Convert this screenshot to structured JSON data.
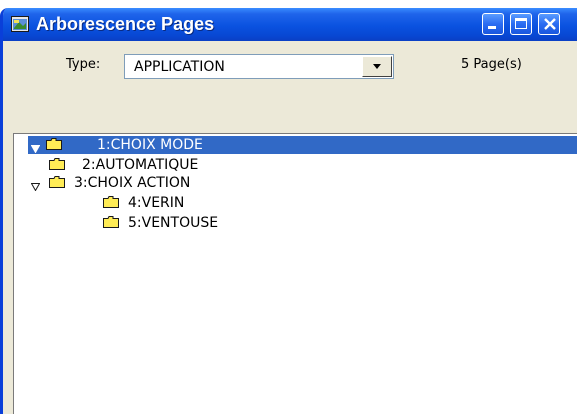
{
  "window": {
    "title": "Arborescence Pages",
    "title_bar_color": "#0a52e0"
  },
  "toolbar": {
    "type_label": "Type:",
    "type_selected": "APPLICATION",
    "page_count": "5  Page(s)"
  },
  "tree": {
    "selection_color": "#3169c6",
    "folder_color": "#ffec56",
    "nodes": [
      {
        "label": "1:CHOIX MODE",
        "level": 0,
        "expanded": true,
        "selected": true
      },
      {
        "label": "2:AUTOMATIQUE",
        "level": 1,
        "expanded": null,
        "selected": false
      },
      {
        "label": "3:CHOIX ACTION",
        "level": 1,
        "expanded": true,
        "selected": false
      },
      {
        "label": "4:VERIN",
        "level": 2,
        "expanded": null,
        "selected": false
      },
      {
        "label": "5:VENTOUSE",
        "level": 2,
        "expanded": null,
        "selected": false
      }
    ]
  }
}
